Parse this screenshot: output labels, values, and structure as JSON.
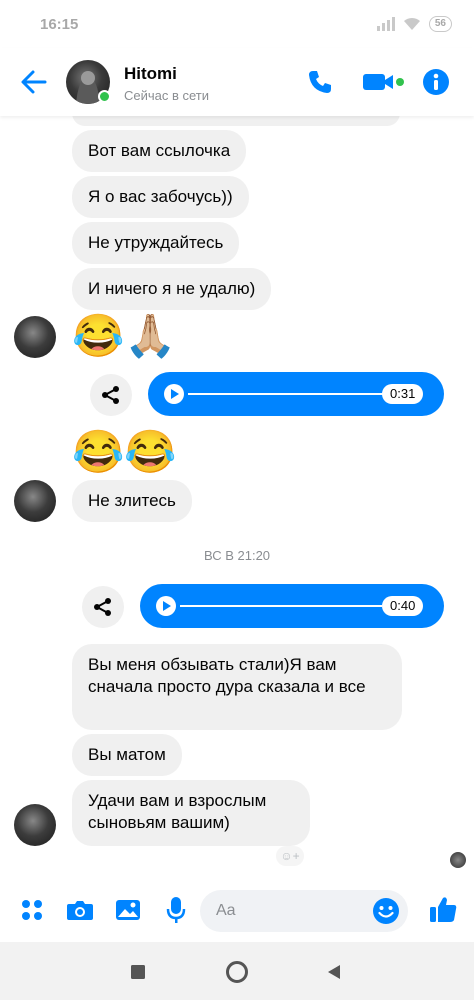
{
  "status_bar": {
    "time": "16:15",
    "battery": "56"
  },
  "header": {
    "name": "Hitomi",
    "status": "Сейчас в сети"
  },
  "messages": [
    {
      "text": "Вот вам ссылочка"
    },
    {
      "text": "Я о вас забочусь))"
    },
    {
      "text": "Не утруждайтесь"
    },
    {
      "text": "И ничего я не удалю)"
    },
    {
      "text": "😂🙏🏼"
    },
    {
      "text": "0:31"
    },
    {
      "text": "😂😂"
    },
    {
      "text": "Не злитесь"
    },
    {
      "text": "ВС В 21:20"
    },
    {
      "text": "0:40"
    },
    {
      "text": "Вы меня обзывать стали)Я вам сначала просто дура сказала и все"
    },
    {
      "text": "Вы матом"
    },
    {
      "text": "Удачи вам и взрослым сыновьям вашим)"
    }
  ],
  "composer": {
    "placeholder": "Aa"
  },
  "colors": {
    "accent": "#0084ff",
    "incoming_bubble": "#f0f0f0",
    "online": "#31c24d"
  },
  "icons": {
    "header": [
      "back-arrow-icon",
      "phone-icon",
      "video-camera-icon",
      "info-icon"
    ],
    "composer": [
      "apps-icon",
      "camera-icon",
      "gallery-icon",
      "microphone-icon",
      "emoji-icon",
      "thumbs-up-icon"
    ],
    "navbar": [
      "square-icon",
      "circle-icon",
      "triangle-icon"
    ]
  }
}
